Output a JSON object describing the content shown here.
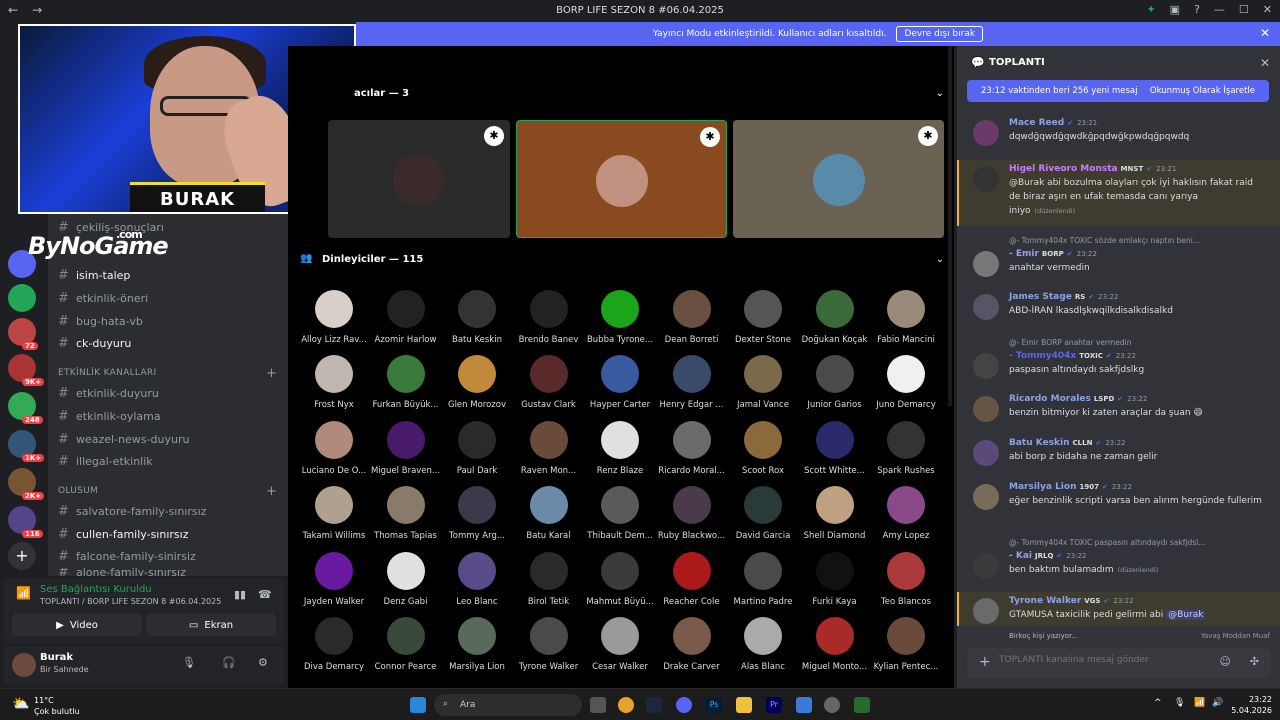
{
  "window": {
    "title": "BORP LIFE SEZON 8 #06.04.2025"
  },
  "banner": {
    "text": "Yayıncı Modu etkinleştirildi. Kullanıcı adları kısaltıldı.",
    "button": "Devre dışı bırak"
  },
  "server_badges": [
    "72",
    "9K+",
    "248",
    "1K+",
    "2K+",
    "116"
  ],
  "streamer": {
    "name": "BURAK",
    "brand": "ByNoGame",
    "brand_suffix": ".com"
  },
  "channels": {
    "items": [
      {
        "label": "çekiliş-sonuçları"
      },
      {
        "label": "isim-talep",
        "bright": true
      },
      {
        "label": "etkinlik-öneri"
      },
      {
        "label": "bug-hata-vb"
      },
      {
        "label": "ck-duyuru",
        "bright": true
      }
    ],
    "category_events": "ETKİNLİK KANALLARI",
    "events": [
      {
        "label": "etkinlik-duyuru"
      },
      {
        "label": "etkinlik-oylama"
      },
      {
        "label": "weazel-news-duyuru"
      },
      {
        "label": "illegal-etkinlik"
      }
    ],
    "category_family": "OLUSUM",
    "families": [
      {
        "label": "salvatore-family-sınırsız"
      },
      {
        "label": "cullen-family-sınırsız",
        "bright": true
      },
      {
        "label": "falcone-family-sinirsiz"
      },
      {
        "label": "alone-family-sınırsız"
      }
    ]
  },
  "voice": {
    "status": "Ses Bağlantısı Kuruldu",
    "channel": "TOPLANTI / BORP LIFE SEZON 8 #06.04.2025",
    "video_label": "Video",
    "screen_label": "Ekran"
  },
  "user": {
    "name": "Burak",
    "status": "Bir Sahnede"
  },
  "stage": {
    "speakers_title": "acılar — 3",
    "listeners_title": "Dinleyiciler — 115",
    "listeners": [
      "Alloy Lizz Rav...",
      "Azomir Harlow",
      "Batu Keskin",
      "Brendo Banev",
      "Bubba Tyrone...",
      "Dean Borreti",
      "Dexter Stone",
      "Doğukan Koçak",
      "Fabio Mancini",
      "Frost Nyx",
      "Furkan Büyük...",
      "Glen Morozov",
      "Gustav Clark",
      "Hayper Carter",
      "Henry Edgar ...",
      "Jamal Vance",
      "Junior Garios",
      "Juno Demarcy",
      "Luciano De O...",
      "Miguel Braven...",
      "Paul Dark",
      "Raven Mon...",
      "Renz Blaze",
      "Ricardo Moral...",
      "Scoot Rox",
      "Scott Whitte...",
      "Spark Rushes",
      "Takami Willims",
      "Thomas Tapias",
      "Tommy Arg...",
      "Batu Karal",
      "Thibault Dem...",
      "Ruby Blackwo...",
      "David Garcia",
      "Shell Diamond",
      "Amy Lopez",
      "Jayden Walker",
      "Denz Gabi",
      "Leo Blanc",
      "Birol Tetik",
      "Mahmut Büyü...",
      "Reacher Cole",
      "Martino Padre",
      "Furki Kaya",
      "Teo Blancos",
      "Diva Demarcy",
      "Connor Pearce",
      "Marsilya Lion",
      "Tyrone Walker",
      "Cesar Walker",
      "Drake Carver",
      "Alas Blanc",
      "Miguel Monto...",
      "Kylian Pentec..."
    ],
    "listener_colors": [
      "#d8d0c8",
      "#222222",
      "#333333",
      "#222222",
      "#1aa51a",
      "#6a5040",
      "#555555",
      "#3a6a3a",
      "#9a8a7a",
      "#c0b8b0",
      "#3a7a3a",
      "#c08a3a",
      "#5a2a2a",
      "#3a5aa0",
      "#3a4a6a",
      "#7a6a4a",
      "#4a4a4a",
      "#f0f0f0",
      "#b08a7a",
      "#4a1a6a",
      "#2a2a2a",
      "#6a4a3a",
      "#e0e0e0",
      "#6a6a6a",
      "#8a6a3a",
      "#2a2a6a",
      "#333333",
      "#b0a090",
      "#8a7a6a",
      "#3a3a4a",
      "#6a8aaa",
      "#5a5a5a",
      "#4a3a4a",
      "#2a3a3a",
      "#c0a080",
      "#8a4a8a",
      "#6a1aa0",
      "#e0e0e0",
      "#5a4a8a",
      "#2a2a2a",
      "#3a3a3a",
      "#aa1a1a",
      "#4a4a4a",
      "#111111",
      "#aa3a3a",
      "#2a2a2a",
      "#3a4a3a",
      "#5a6a5a",
      "#4a4a4a",
      "#9a9a9a",
      "#7a5a4a",
      "#aaaaaa",
      "#aa2a2a",
      "#6a4a3a"
    ]
  },
  "chat": {
    "title": "TOPLANTI",
    "newbar_text": "23:12 vaktinden beri 256 yeni mesaj",
    "newbar_action": "Okunmuş Olarak İşaretle",
    "messages": [
      {
        "author": "Mace Reed",
        "color": "#8ea1e1",
        "time": "23:21",
        "text": "dqwdğqwdğqwdkğpqdwğkpwdqğpqwdq"
      },
      {
        "author": "Higel Riveoro Monsta",
        "color": "#c77dff",
        "tag": "MNST",
        "time": "23:21",
        "text": "@Burak abi bozulma olayları çok iyi haklısın fakat raid de biraz aşırı en ufak temasda canı yarıya iniyo",
        "note": "(düzenlendi)"
      },
      {
        "reply": "@- Tommy404x  TOXIC  sözde emlakçı naptın beni...",
        "author": "- Emir",
        "color": "#9aa0f0",
        "tag": "BORP",
        "time": "23:22",
        "text": "anahtar vermedin"
      },
      {
        "author": "James Stage",
        "color": "#8ea1e1",
        "tag": "RS",
        "time": "23:22",
        "text": "ABD-İRAN lkasdlşkwqilkdisalkdisalkd"
      },
      {
        "reply": "@- Emir  BORP  anahtar vermedin",
        "author": "- Tommy404x",
        "color": "#5865f2",
        "tag": "TOXIC",
        "time": "23:22",
        "text": "paspasın altındaydı sakfjdslkg"
      },
      {
        "author": "Ricardo Morales",
        "color": "#8ea1e1",
        "tag": "LSPD",
        "time": "23:22",
        "text": "benzin bitmiyor ki zaten araçlar da şuan 😄"
      },
      {
        "author": "Batu Keskin",
        "color": "#8ea1e1",
        "tag": "CLLN",
        "time": "23:22",
        "text": "abi borp z bidaha ne zaman gelir"
      },
      {
        "author": "Marsilya Lion",
        "color": "#8ea1e1",
        "tag": "1907",
        "time": "23:22",
        "text": "eğer benzinlik scripti varsa ben alırım hergünde fullerim"
      },
      {
        "reply": "@- Tommy404x  TOXIC  paspasın altındaydı sakfjdsl...",
        "author": "- Kai",
        "color": "#9aa0f0",
        "tag": "JRLQ",
        "time": "23:22",
        "text": "ben baktım bulamadım",
        "note": "(düzenlendi)"
      },
      {
        "author": "Tyrone Walker",
        "color": "#8ea1e1",
        "tag": "VGS",
        "time": "23:22",
        "text": "GTAMUSA taxicilik pedi gelirmi abi",
        "mention": "@Burak"
      }
    ],
    "typing": "Birkoç kişi yazıyor...",
    "slowmode": "Yavaş Moddan Muaf",
    "placeholder": "TOPLANTI kanalına mesaj gönder"
  },
  "taskbar": {
    "weather_temp": "11°C",
    "weather_desc": "Çok bulutlu",
    "search": "Ara",
    "time": "23:22",
    "date": "5.04.2026"
  }
}
